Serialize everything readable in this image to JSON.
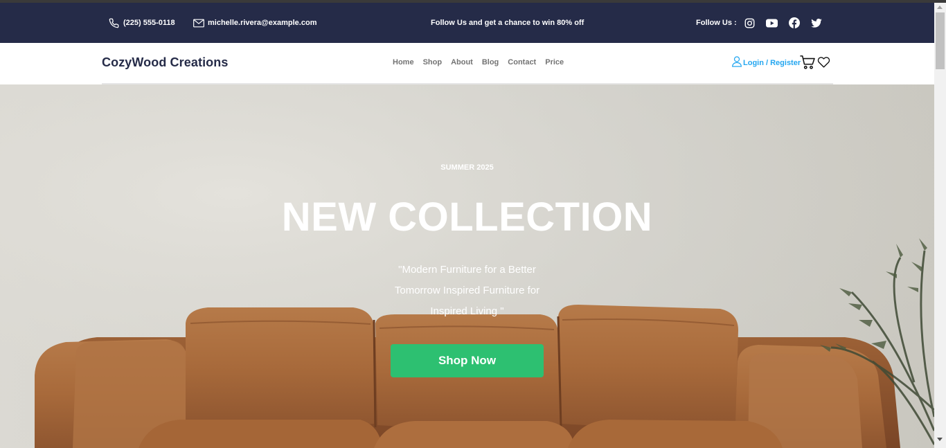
{
  "topbar": {
    "phone": "(225) 555-0118",
    "email": "michelle.rivera@example.com",
    "promo": "Follow Us and get a chance to win 80% off",
    "follow_label": "Follow Us :",
    "social_icons": [
      "instagram-icon",
      "youtube-icon",
      "facebook-icon",
      "twitter-icon"
    ],
    "background_color": "#252b48"
  },
  "navbar": {
    "brand": "CozyWood Creations",
    "links": [
      "Home",
      "Shop",
      "About",
      "Blog",
      "Contact",
      "Price"
    ],
    "login_label": "Login / Register",
    "icons": [
      "user-icon",
      "cart-icon",
      "heart-icon"
    ],
    "accent_color": "#23a6f0"
  },
  "hero": {
    "subtitle": "SUMMER 2025",
    "title": "NEW COLLECTION",
    "description": "\"Modern Furniture for a Better Tomorrow Inspired Furniture for Inspired Living \"",
    "button_label": "Shop Now",
    "button_color": "#2dc071"
  }
}
